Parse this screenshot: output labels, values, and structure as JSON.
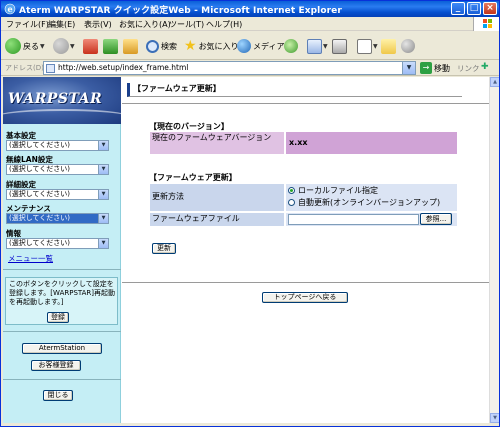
{
  "window": {
    "title": "Aterm WARPSTAR クイック設定Web - Microsoft Internet Explorer",
    "min": "_",
    "max": "□",
    "close": "×"
  },
  "menubar": {
    "items": [
      "ファイル(F)",
      "編集(E)",
      "表示(V)",
      "お気に入り(A)",
      "ツール(T)",
      "ヘルプ(H)"
    ]
  },
  "toolbar": {
    "back_label": "戻る",
    "search_label": "検索",
    "favorites_label": "お気に入り",
    "media_label": "メディア"
  },
  "address": {
    "label": "アドレス(D)",
    "url": "http://web.setup/index_frame.html",
    "go_label": "移動",
    "links_label": "リンク"
  },
  "sidebar": {
    "logo_text": "WARPSTAR",
    "groups": [
      {
        "label": "基本設定",
        "selected": "(選択してください)"
      },
      {
        "label": "無線LAN設定",
        "selected": "(選択してください)"
      },
      {
        "label": "詳細設定",
        "selected": "(選択してください)"
      },
      {
        "label": "メンテナンス",
        "selected": "(選択してください)"
      },
      {
        "label": "情報",
        "selected": "(選択してください)"
      }
    ],
    "menu_list_link": "メニュー一覧",
    "help_text": "このボタンをクリックして設定を登録します。[WARPSTAR]再起動を再起動します。]",
    "register_button": "登録",
    "aterm_station_button": "AtermStation",
    "customer_register_button": "お客様登録",
    "close_button": "閉じる"
  },
  "main": {
    "page_title": "【ファームウェア更新】",
    "current_version": {
      "heading": "【現在のバージョン】",
      "label": "現在のファームウェアバージョン",
      "value": "x.xx"
    },
    "firmware_update": {
      "heading": "【ファームウェア更新】",
      "method_label": "更新方法",
      "options": [
        "ローカルファイル指定",
        "自動更新(オンラインバージョンアップ)"
      ],
      "selected_option": "ローカルファイル指定",
      "file_label": "ファームウェアファイル",
      "file_value": "",
      "browse_button": "参照..."
    },
    "update_button": "更新",
    "top_page_button": "トップページへ戻る"
  },
  "colors": {
    "sidebar_bg": "#c5eef5",
    "title_bar": "#0a5fd8",
    "pink_cell": "#e0c2e3",
    "blue_cell": "#c9d6ec"
  }
}
